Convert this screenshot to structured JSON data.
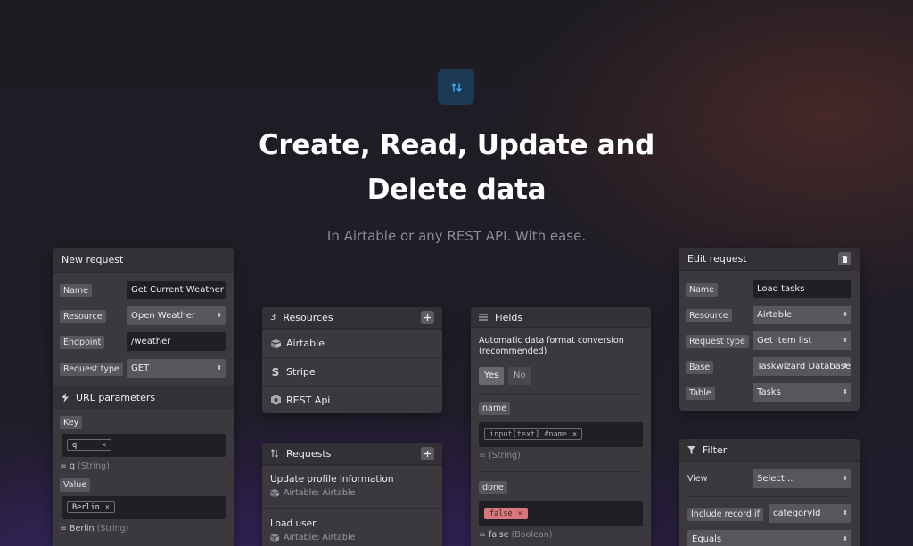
{
  "hero": {
    "title_line1": "Create, Read, Update and",
    "title_line2": "Delete data",
    "subtitle": "In Airtable or any REST API. With ease.",
    "icon": "arrows-up-down-icon"
  },
  "new_request": {
    "title": "New request",
    "fields": [
      {
        "label": "Name",
        "value": "Get Current Weather",
        "kind": "input"
      },
      {
        "label": "Resource",
        "value": "Open Weather",
        "kind": "select"
      },
      {
        "label": "Endpoint",
        "value": "/weather",
        "kind": "input"
      },
      {
        "label": "Request type",
        "value": "GET",
        "kind": "select"
      }
    ],
    "url_params": {
      "title": "URL parameters",
      "key_label": "Key",
      "key_tag": "q",
      "key_hint": "= q",
      "key_type": "(String)",
      "value_label": "Value",
      "value_tag": "Berlin",
      "value_hint": "= Berlin",
      "value_type": "(String)"
    }
  },
  "resources": {
    "count": "3",
    "title": "Resources",
    "items": [
      "Airtable",
      "Stripe",
      "REST Api"
    ]
  },
  "requests": {
    "title": "Requests",
    "items": [
      {
        "title": "Update profile information",
        "source": "Airtable:",
        "name": "Airtable"
      },
      {
        "title": "Load user",
        "source": "Airtable:",
        "name": "Airtable"
      }
    ]
  },
  "fields": {
    "title": "Fields",
    "conversion_label": "Automatic data format conversion (recommended)",
    "yes": "Yes",
    "no": "No",
    "name_field": {
      "label": "name",
      "tag": "input[text] #name",
      "hint": "=",
      "type": "(String)"
    },
    "done_field": {
      "label": "done",
      "tag": "false",
      "hint": "= false",
      "type": "(Boolean)"
    }
  },
  "edit_request": {
    "title": "Edit request",
    "fields": [
      {
        "label": "Name",
        "value": "Load tasks",
        "kind": "input"
      },
      {
        "label": "Resource",
        "value": "Airtable",
        "kind": "select"
      },
      {
        "label": "Request type",
        "value": "Get item list",
        "kind": "select"
      },
      {
        "label": "Base",
        "value": "Taskwizard Database",
        "kind": "select"
      },
      {
        "label": "Table",
        "value": "Tasks",
        "kind": "select"
      }
    ]
  },
  "filter": {
    "title": "Filter",
    "view_label": "View",
    "view_value": "Select...",
    "include_label": "Include record if",
    "include_value": "categoryId",
    "op_value": "Equals"
  },
  "colors": {
    "accent": "#3ea8f5",
    "danger_tag": "#d9787c"
  }
}
